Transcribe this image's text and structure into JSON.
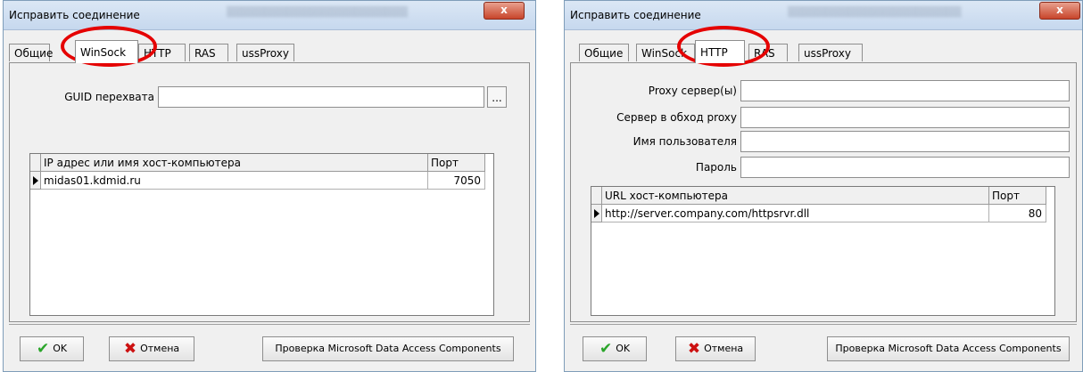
{
  "dialogs": [
    {
      "title": "Исправить соединение",
      "tabs": [
        "Общие",
        "WinSock",
        "HTTP",
        "RAS",
        "ussProxy"
      ],
      "active_tab": "WinSock",
      "guid_label": "GUID перехвата",
      "guid_value": "",
      "browse_label": "...",
      "grid": {
        "columns": [
          "IP адрес или имя хост-компьютера",
          "Порт"
        ],
        "rows": [
          [
            "midas01.kdmid.ru",
            "7050"
          ]
        ]
      },
      "ok_label": "OK",
      "cancel_label": "Отмена",
      "check_label": "Проверка Microsoft Data Access Components",
      "close_label": "x"
    },
    {
      "title": "Исправить соединение",
      "tabs": [
        "Общие",
        "WinSock",
        "HTTP",
        "RAS",
        "ussProxy"
      ],
      "active_tab": "HTTP",
      "fields": [
        {
          "label": "Proxy сервер(ы)",
          "value": ""
        },
        {
          "label": "Сервер в обход proxy",
          "value": ""
        },
        {
          "label": "Имя пользователя",
          "value": ""
        },
        {
          "label": "Пароль",
          "value": ""
        }
      ],
      "grid": {
        "columns": [
          "URL хост-компьютера",
          "Порт"
        ],
        "rows": [
          [
            "http://server.company.com/httpsrvr.dll",
            "80"
          ]
        ]
      },
      "ok_label": "OK",
      "cancel_label": "Отмена",
      "check_label": "Проверка Microsoft Data Access Components",
      "close_label": "x"
    }
  ],
  "colors": {
    "highlight_circle": "#e50000",
    "ok_icon": "#2aa52a",
    "cancel_icon": "#cc1111"
  },
  "icons": {
    "ok": "check-icon",
    "cancel": "cross-icon"
  }
}
